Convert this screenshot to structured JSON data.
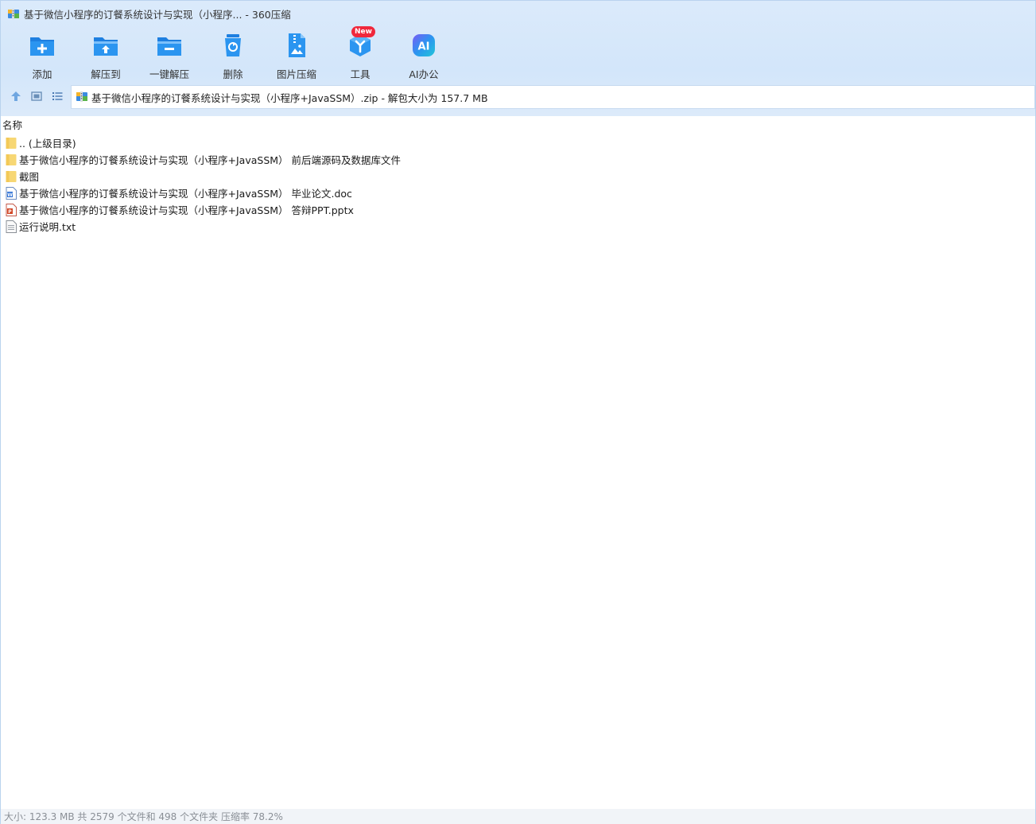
{
  "window": {
    "title": "基于微信小程序的订餐系统设计与实现（小程序... - 360压缩"
  },
  "toolbar": {
    "buttons": [
      {
        "label": "添加",
        "icon": "folder-add-icon"
      },
      {
        "label": "解压到",
        "icon": "folder-extract-icon"
      },
      {
        "label": "一键解压",
        "icon": "folder-minus-icon"
      },
      {
        "label": "删除",
        "icon": "trash-icon"
      },
      {
        "label": "图片压缩",
        "icon": "image-compress-icon"
      },
      {
        "label": "工具",
        "icon": "tools-cube-icon"
      },
      {
        "label": "AI办公",
        "icon": "ai-office-icon"
      }
    ],
    "new_badge": "New"
  },
  "nav": {
    "address": "基于微信小程序的订餐系统设计与实现（小程序+JavaSSM）.zip - 解包大小为 157.7 MB"
  },
  "list": {
    "column_name": "名称",
    "items": [
      {
        "name": ".. (上级目录)",
        "type": "folder"
      },
      {
        "name": "基于微信小程序的订餐系统设计与实现（小程序+JavaSSM） 前后端源码及数据库文件",
        "type": "folder"
      },
      {
        "name": "截图",
        "type": "folder"
      },
      {
        "name": "基于微信小程序的订餐系统设计与实现（小程序+JavaSSM） 毕业论文.doc",
        "type": "doc"
      },
      {
        "name": "基于微信小程序的订餐系统设计与实现（小程序+JavaSSM） 答辩PPT.pptx",
        "type": "ppt"
      },
      {
        "name": "运行说明.txt",
        "type": "txt"
      }
    ]
  },
  "status": {
    "text": "大小: 123.3 MB 共 2579 个文件和 498 个文件夹 压缩率 78.2%"
  },
  "colors": {
    "accent": "#1e88e5",
    "header_bg": "#d3e6fa",
    "badge": "#f0283c",
    "folder": "#f7d774"
  }
}
